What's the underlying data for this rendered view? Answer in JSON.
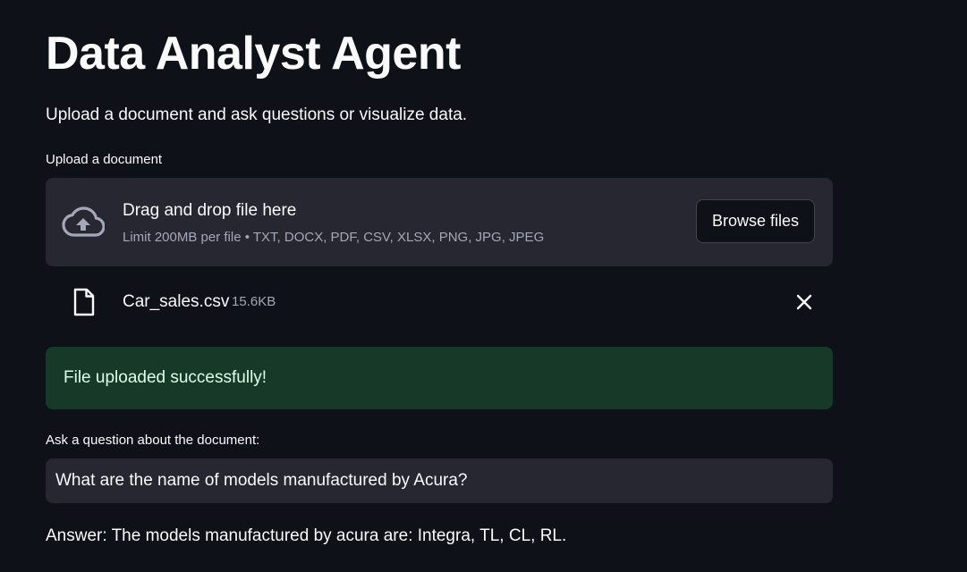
{
  "page": {
    "title": "Data Analyst Agent",
    "subtitle": "Upload a document and ask questions or visualize data."
  },
  "uploader": {
    "label": "Upload a document",
    "dropzone_title": "Drag and drop file here",
    "dropzone_hint": "Limit 200MB per file • TXT, DOCX, PDF, CSV, XLSX, PNG, JPG, JPEG",
    "browse_label": "Browse files",
    "upload_icon": "cloud-upload-icon",
    "file": {
      "name": "Car_sales.csv",
      "size": "15.6KB",
      "icon": "file-icon",
      "remove_icon": "close-icon"
    }
  },
  "status": {
    "message": "File uploaded successfully!",
    "color": "#173928"
  },
  "question": {
    "label": "Ask a question about the document:",
    "value": "What are the name of models manufactured by Acura?"
  },
  "answer": {
    "text": "Answer: The models manufactured by acura are: Integra, TL, CL, RL."
  },
  "theme": {
    "background": "#0e1117",
    "surface": "#262730",
    "text": "#fafafa",
    "muted": "#a3a8b8"
  }
}
